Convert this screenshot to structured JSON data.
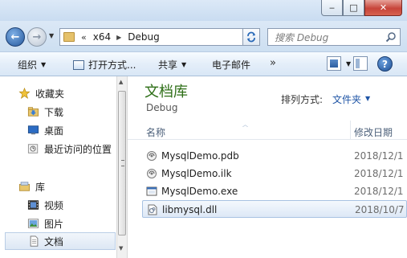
{
  "window": {
    "controls": {
      "minimize": "‒",
      "maximize": "□",
      "close": "✕"
    }
  },
  "address": {
    "chevron": "«",
    "segments": [
      "x64",
      "Debug"
    ],
    "search_placeholder": "搜索 Debug"
  },
  "toolbar": {
    "organize": "组织",
    "open_with": "打开方式...",
    "share": "共享",
    "email": "电子邮件",
    "more": "»",
    "help": "?"
  },
  "navpane": {
    "items": [
      {
        "label": "收藏夹",
        "icon": "star-icon"
      },
      {
        "label": "下载",
        "icon": "downloads-folder-icon"
      },
      {
        "label": "桌面",
        "icon": "desktop-icon"
      },
      {
        "label": "最近访问的位置",
        "icon": "recent-places-icon"
      },
      {
        "label": "库",
        "icon": "libraries-icon"
      },
      {
        "label": "视频",
        "icon": "videos-icon"
      },
      {
        "label": "图片",
        "icon": "pictures-icon"
      },
      {
        "label": "文档",
        "icon": "documents-icon"
      }
    ]
  },
  "library": {
    "title": "文档库",
    "subtitle": "Debug",
    "arrange_label": "排列方式:",
    "arrange_value": "文件夹"
  },
  "columns": {
    "name": "名称",
    "date": "修改日期"
  },
  "files": [
    {
      "name": "MysqlDemo.pdb",
      "date": "2018/12/1",
      "icon": "pdb-file-icon"
    },
    {
      "name": "MysqlDemo.ilk",
      "date": "2018/12/1",
      "icon": "ilk-file-icon"
    },
    {
      "name": "MysqlDemo.exe",
      "date": "2018/12/1",
      "icon": "exe-file-icon"
    },
    {
      "name": "libmysql.dll",
      "date": "2018/10/7",
      "icon": "dll-file-icon",
      "selected": true
    }
  ]
}
